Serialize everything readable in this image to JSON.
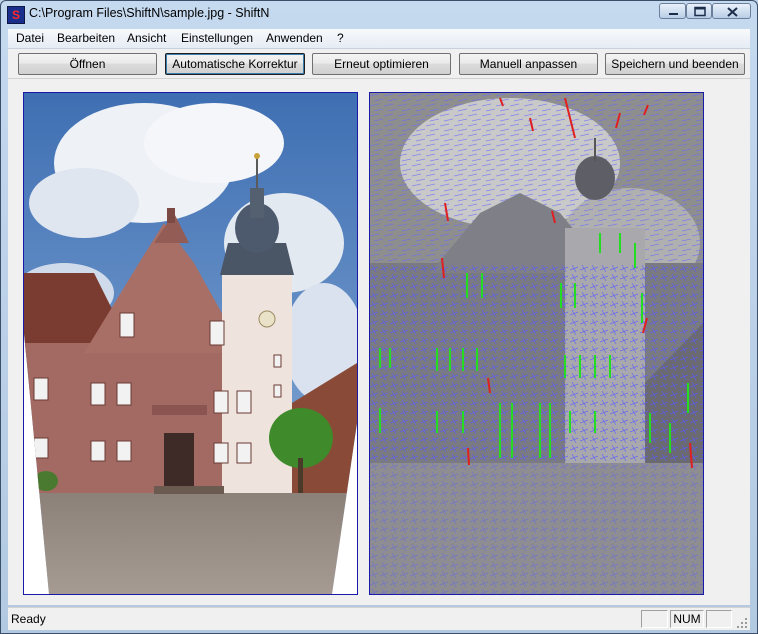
{
  "window": {
    "title": "C:\\Program Files\\ShiftN\\sample.jpg - ShiftN",
    "app_icon_letter": "S"
  },
  "menu": {
    "items": [
      {
        "label": "Datei"
      },
      {
        "label": "Bearbeiten"
      },
      {
        "label": "Ansicht"
      },
      {
        "label": "Einstellungen"
      },
      {
        "label": "Anwenden"
      },
      {
        "label": "?"
      }
    ]
  },
  "toolbar": {
    "buttons": [
      {
        "label": "Öffnen",
        "pressed": false
      },
      {
        "label": "Automatische Korrektur",
        "pressed": true
      },
      {
        "label": "Erneut optimieren",
        "pressed": false
      },
      {
        "label": "Manuell anpassen",
        "pressed": false
      },
      {
        "label": "Speichern und beenden",
        "pressed": false
      }
    ]
  },
  "images": {
    "left": "corrected-photo",
    "right": "line-detection-overlay",
    "line_colors": {
      "vertical": "#22dd22",
      "tilted": "#e02020",
      "edges": "#5a5aff"
    }
  },
  "status": {
    "text": "Ready",
    "indicators": [
      "",
      "NUM",
      ""
    ]
  }
}
